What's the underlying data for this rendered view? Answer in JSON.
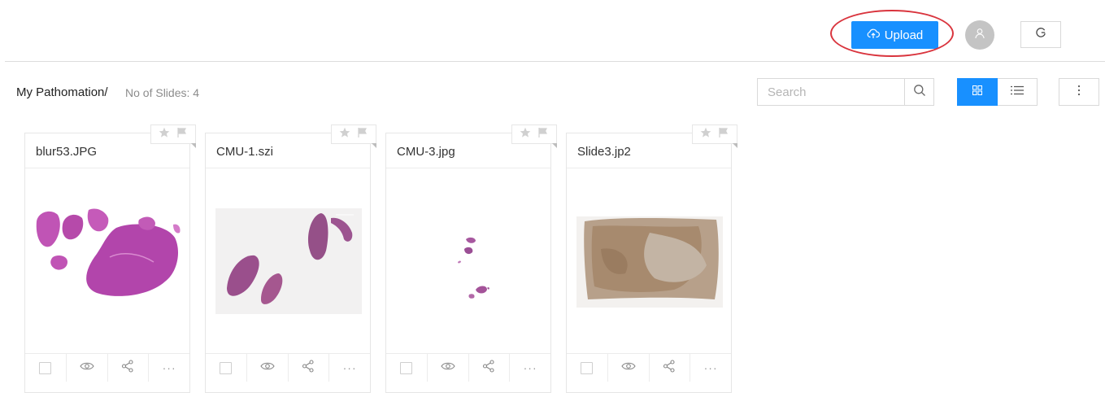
{
  "header": {
    "upload_label": "Upload",
    "accent_color": "#1890ff",
    "highlight_color": "#d9343d",
    "icons": [
      "cloud-upload-icon",
      "user-icon",
      "refresh-icon"
    ]
  },
  "toolbar": {
    "breadcrumb": "My Pathomation/",
    "slide_count": "No of Slides: 4",
    "search_placeholder": "Search",
    "view_mode": "grid",
    "icons": [
      "search-icon",
      "grid-view-icon",
      "list-view-icon",
      "more-icon"
    ]
  },
  "slides": [
    {
      "name": "blur53.JPG",
      "thumbnail": "pink-tissue-fragments"
    },
    {
      "name": "CMU-1.szi",
      "thumbnail": "purple-kidney-sections"
    },
    {
      "name": "CMU-3.jpg",
      "thumbnail": "small-scattered-fragments"
    },
    {
      "name": "Slide3.jp2",
      "thumbnail": "brown-stained-section"
    }
  ],
  "card_actions": [
    "checkbox",
    "eye-icon",
    "share-icon",
    "ellipsis-icon"
  ],
  "card_badges": [
    "star-icon",
    "flag-icon"
  ]
}
